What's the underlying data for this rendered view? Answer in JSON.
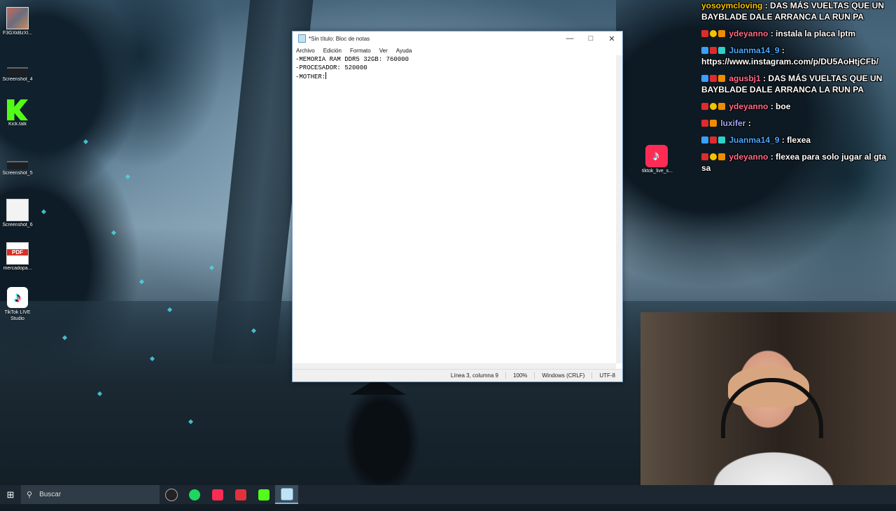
{
  "desktop": {
    "icons": [
      {
        "label": "F3GXkBzXl..."
      },
      {
        "label": "Screenshot_4"
      },
      {
        "label": "Kick.talk"
      },
      {
        "label": "Screenshot_5"
      },
      {
        "label": "Screenshot_6"
      },
      {
        "label": "mercadopa..."
      },
      {
        "label": "TikTok LIVE Studio"
      }
    ],
    "right_icon_label": "tiktok_live_s..."
  },
  "notepad": {
    "title": "*Sin título: Bloc de notas",
    "menu": [
      "Archivo",
      "Edición",
      "Formato",
      "Ver",
      "Ayuda"
    ],
    "lines": [
      "-MEMORIA RAM DDR5 32GB: 760000",
      "-PROCESADOR: 520000",
      "-MOTHER:"
    ],
    "status": {
      "position": "Línea 3, columna 9",
      "zoom": "100%",
      "line_endings": "Windows (CRLF)",
      "encoding": "UTF-8"
    }
  },
  "chat": {
    "messages": [
      {
        "user": "yosoymcloving",
        "user_color": "#f5c400",
        "text": ": DAS MÁS VUELTAS QUE UN BAYBLADE DALE ARRANCA LA RUN PA"
      },
      {
        "user": "ydeyanno",
        "user_color": "#ff6b8a",
        "text": ": instala la placa lptm"
      },
      {
        "user": "Juanma14_9",
        "user_color": "#4aa8ff",
        "text": ": https://www.instagram.com/p/DU5AoHtjCFb/"
      },
      {
        "user": "agusbj1",
        "user_color": "#ff6b8a",
        "text": ": DAS MÁS VUELTAS QUE UN BAYBLADE DALE ARRANCA LA RUN PA"
      },
      {
        "user": "ydeyanno",
        "user_color": "#ff6b8a",
        "text": ": boe"
      },
      {
        "user": "luxifer",
        "user_color": "#9fa8ff",
        "text": ":"
      },
      {
        "user": "Juanma14_9",
        "user_color": "#4aa8ff",
        "text": ": flexea"
      },
      {
        "user": "ydeyanno",
        "user_color": "#ff6b8a",
        "text": ": flexea para solo jugar al gta sa"
      }
    ]
  },
  "taskbar": {
    "search_placeholder": "Buscar"
  }
}
